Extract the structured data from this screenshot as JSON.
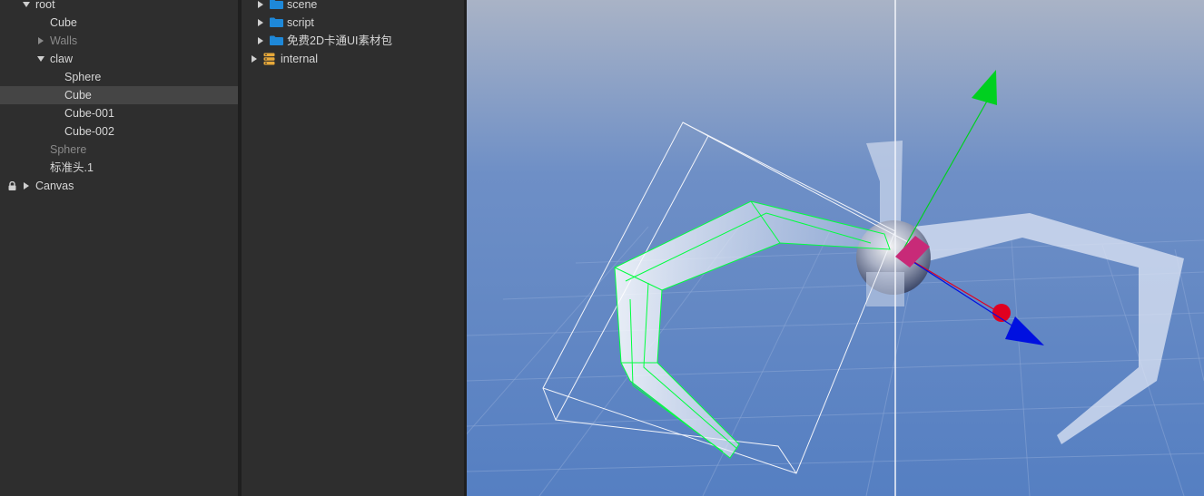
{
  "hierarchy": {
    "nodes": [
      {
        "label": "root"
      },
      {
        "label": "Cube"
      },
      {
        "label": "Walls"
      },
      {
        "label": "claw"
      },
      {
        "label": "Sphere"
      },
      {
        "label": "Cube"
      },
      {
        "label": "Cube-001"
      },
      {
        "label": "Cube-002"
      },
      {
        "label": "Sphere"
      },
      {
        "label": "标准头.1"
      },
      {
        "label": "Canvas"
      }
    ],
    "selected_index": 5
  },
  "assets": {
    "items": [
      {
        "label": "scene",
        "icon": "folder-icon"
      },
      {
        "label": "script",
        "icon": "folder-icon"
      },
      {
        "label": "免费2D卡通UI素材包",
        "icon": "folder-icon"
      },
      {
        "label": "internal",
        "icon": "database-icon"
      }
    ]
  },
  "scene": {
    "gizmo_axes": [
      "y-axis",
      "x-axis",
      "z-axis"
    ],
    "colors": {
      "x_axis": "#e00020",
      "y_axis": "#00d020",
      "z_axis": "#0010e0",
      "selection": "#00ff40"
    }
  }
}
